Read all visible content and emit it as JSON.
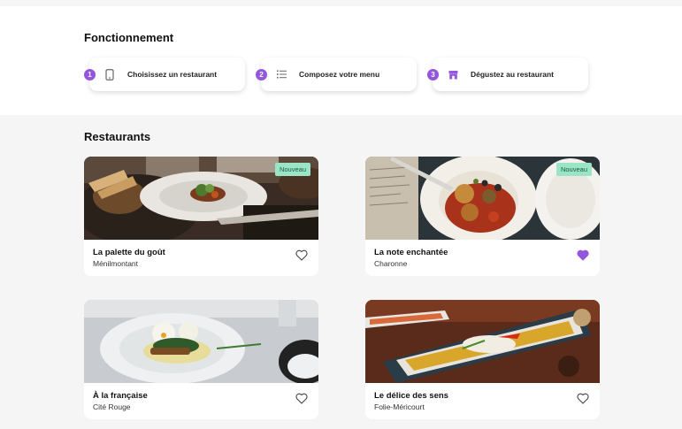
{
  "how_it_works": {
    "title": "Fonctionnement",
    "steps": [
      {
        "number": "1",
        "label": "Choisissez un restaurant",
        "icon": "phone-icon"
      },
      {
        "number": "2",
        "label": "Composez votre menu",
        "icon": "list-icon"
      },
      {
        "number": "3",
        "label": "Dégustez au restaurant",
        "icon": "store-icon"
      }
    ]
  },
  "restaurants": {
    "title": "Restaurants",
    "items": [
      {
        "name": "La palette du goût",
        "location": "Ménilmontant",
        "badge": "Nouveau",
        "favorite": false
      },
      {
        "name": "La note enchantée",
        "location": "Charonne",
        "badge": "Nouveau",
        "favorite": true
      },
      {
        "name": "À la française",
        "location": "Cité Rouge",
        "badge": "",
        "favorite": false
      },
      {
        "name": "Le délice des sens",
        "location": "Folie-Méricourt",
        "badge": "",
        "favorite": false
      }
    ]
  },
  "colors": {
    "accent": "#9356dc",
    "badge_bg": "#9be4c6",
    "section_bg": "#f5f5f5"
  }
}
